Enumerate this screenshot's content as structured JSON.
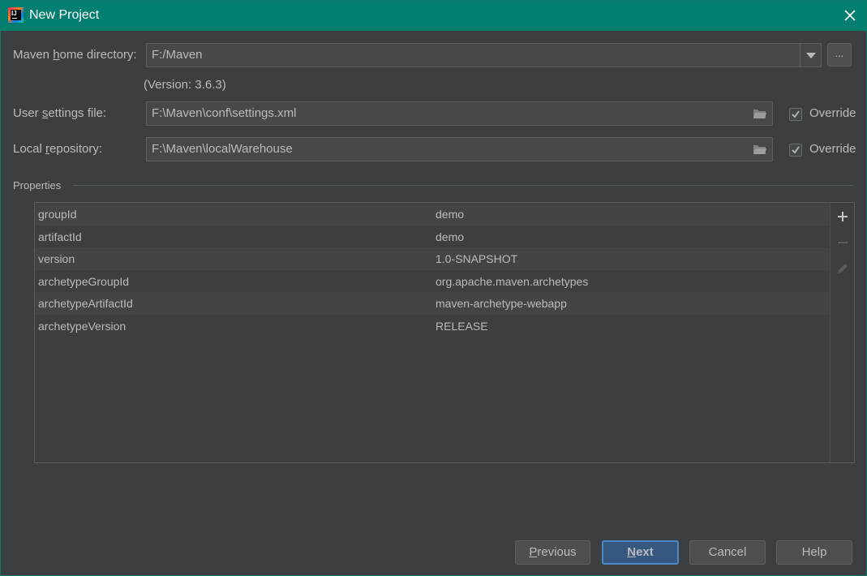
{
  "window": {
    "title": "New Project"
  },
  "maven_home": {
    "label_pre": "Maven ",
    "label_mnemonic": "h",
    "label_post": "ome directory:",
    "value": "F:/Maven",
    "version": "(Version: 3.6.3)",
    "browse_label": "..."
  },
  "user_settings": {
    "label_pre": "User ",
    "label_mnemonic": "s",
    "label_post": "ettings file:",
    "value": "F:\\Maven\\conf\\settings.xml",
    "override_label": "Override",
    "override_checked": true
  },
  "local_repo": {
    "label_pre": "Local ",
    "label_mnemonic": "r",
    "label_post": "epository:",
    "value": "F:\\Maven\\localWarehouse",
    "override_label": "Override",
    "override_checked": true
  },
  "properties": {
    "title": "Properties",
    "rows": [
      {
        "key": "groupId",
        "value": "demo"
      },
      {
        "key": "artifactId",
        "value": "demo"
      },
      {
        "key": "version",
        "value": "1.0-SNAPSHOT"
      },
      {
        "key": "archetypeGroupId",
        "value": "org.apache.maven.archetypes"
      },
      {
        "key": "archetypeArtifactId",
        "value": "maven-archetype-webapp"
      },
      {
        "key": "archetypeVersion",
        "value": "RELEASE"
      }
    ]
  },
  "buttons": {
    "previous_mnemonic": "P",
    "previous_rest": "revious",
    "next_mnemonic": "N",
    "next_rest": "ext",
    "cancel": "Cancel",
    "help": "Help"
  },
  "colors": {
    "titlebar": "#007e6f",
    "background": "#3c3f41",
    "primary_button": "#365880"
  },
  "icons": [
    "intellij-app-icon",
    "close-icon",
    "chevron-down-icon",
    "folder-icon",
    "checkmark-icon",
    "plus-icon",
    "minus-icon",
    "pencil-icon"
  ]
}
